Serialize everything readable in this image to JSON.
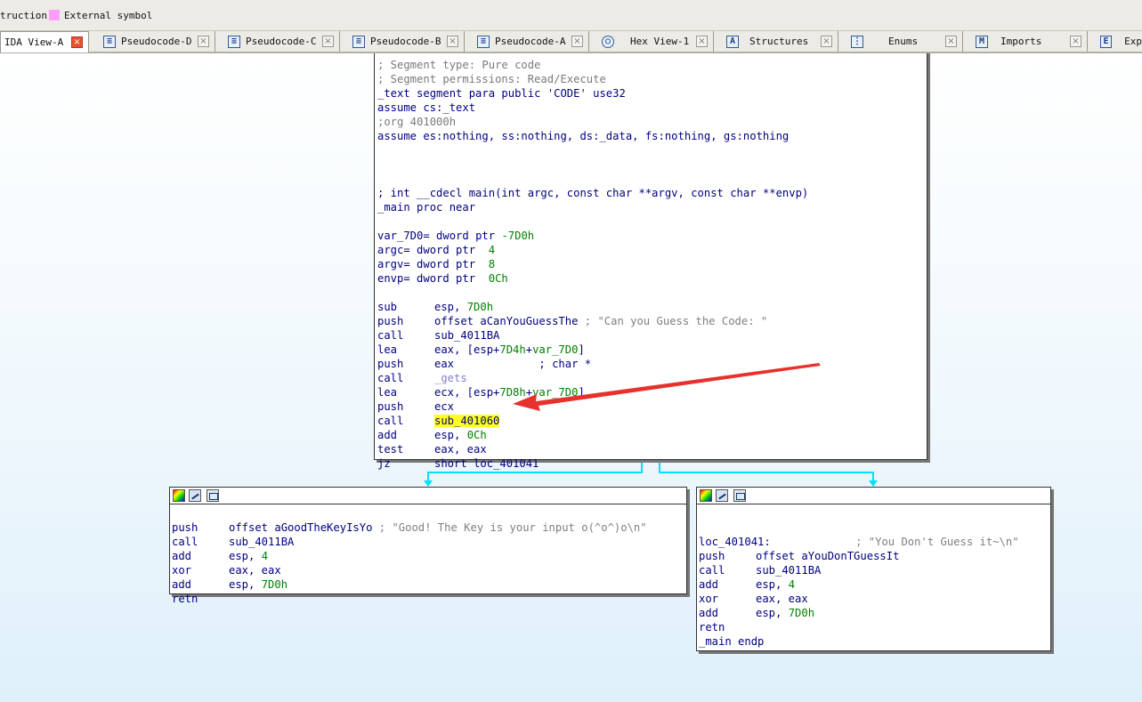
{
  "legend": {
    "instruction_label": "truction",
    "external_label": "External symbol",
    "external_color": "#ff9eff"
  },
  "tabs": [
    {
      "label": "IDA View-A",
      "icon": "ida-view-icon",
      "active": true
    },
    {
      "label": "Pseudocode-D",
      "icon": "pseudocode-icon"
    },
    {
      "label": "Pseudocode-C",
      "icon": "pseudocode-icon"
    },
    {
      "label": "Pseudocode-B",
      "icon": "pseudocode-icon"
    },
    {
      "label": "Pseudocode-A",
      "icon": "pseudocode-icon"
    },
    {
      "label": "Hex View-1",
      "icon": "hex-view-icon"
    },
    {
      "label": "Structures",
      "icon": "structures-icon"
    },
    {
      "label": "Enums",
      "icon": "enums-icon"
    },
    {
      "label": "Imports",
      "icon": "imports-icon"
    },
    {
      "label": "Exp",
      "icon": "exports-icon"
    }
  ],
  "main_block": {
    "header_fragment": "; Segment type: Pure code",
    "segment_lines": [
      "; Segment permissions: Read/Execute",
      "_text segment para public 'CODE' use32",
      "assume cs:_text",
      ";org 401000h",
      "assume es:nothing, ss:nothing, ds:_data, fs:nothing, gs:nothing"
    ],
    "proto": "; int __cdecl main(int argc, const char **argv, const char **envp)",
    "proc": "_main proc near",
    "vars": [
      {
        "name": "var_7D0",
        "eq": "= dword ptr ",
        "val": "-7D0h"
      },
      {
        "name": "argc",
        "eq": "= dword ptr  ",
        "val": "4"
      },
      {
        "name": "argv",
        "eq": "= dword ptr  ",
        "val": "8"
      },
      {
        "name": "envp",
        "eq": "= dword ptr  ",
        "val": "0Ch"
      }
    ],
    "instructions": {
      "i0": {
        "mn": "sub",
        "a": "esp, ",
        "n": "7D0h"
      },
      "i1": {
        "mn": "push",
        "a": "offset aCanYouGuessThe",
        "c": " ; \"Can you Guess the Code: \""
      },
      "i2": {
        "mn": "call",
        "a": "sub_4011BA"
      },
      "i3": {
        "mn": "lea",
        "a": "eax, [esp+",
        "n": "7D4h",
        "b": "+",
        "v": "var_7D0",
        "e": "]"
      },
      "i4": {
        "mn": "push",
        "a": "eax",
        "c": "             ; char *"
      },
      "i5": {
        "mn": "call",
        "lib": "_gets"
      },
      "i6": {
        "mn": "lea",
        "a": "ecx, [esp+",
        "n": "7D8h",
        "b": "+",
        "v": "var_7D0",
        "e": "]"
      },
      "i7": {
        "mn": "push",
        "a": "ecx"
      },
      "i8": {
        "mn": "call",
        "hl": "sub_401060"
      },
      "i9": {
        "mn": "add",
        "a": "esp, ",
        "n": "0Ch"
      },
      "i10": {
        "mn": "test",
        "a": "eax, eax"
      },
      "i11": {
        "mn": "jz",
        "a": "short loc_401041"
      }
    }
  },
  "left_block": {
    "l0": {
      "mn": "push",
      "a": "offset aGoodTheKeyIsYo",
      "c": " ; \"Good! The Key is your input o(^o^)o\\n\""
    },
    "l1": {
      "mn": "call",
      "a": "sub_4011BA"
    },
    "l2": {
      "mn": "add",
      "a": "esp, ",
      "n": "4"
    },
    "l3": {
      "mn": "xor",
      "a": "eax, eax"
    },
    "l4": {
      "mn": "add",
      "a": "esp, ",
      "n": "7D0h"
    },
    "l5": {
      "mn": "retn"
    }
  },
  "right_block": {
    "label": "loc_401041:",
    "label_comment": "             ; \"You Don't Guess it~\\n\"",
    "r0": {
      "mn": "push",
      "a": "offset aYouDonTGuessIt"
    },
    "r1": {
      "mn": "call",
      "a": "sub_4011BA"
    },
    "r2": {
      "mn": "add",
      "a": "esp, ",
      "n": "4"
    },
    "r3": {
      "mn": "xor",
      "a": "eax, eax"
    },
    "r4": {
      "mn": "add",
      "a": "esp, ",
      "n": "7D0h"
    },
    "r5": {
      "mn": "retn"
    },
    "endp": "_main endp"
  },
  "annotation": {
    "arrow_color": "#e8302c"
  },
  "colors": {
    "edge": "#00e0ff",
    "highlight": "#ffff20"
  }
}
